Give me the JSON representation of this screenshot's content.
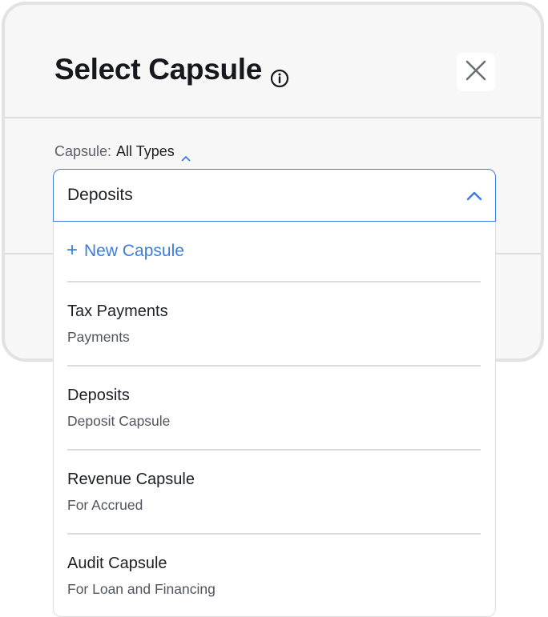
{
  "modal": {
    "title": "Select Capsule",
    "info_icon": "info-circle-icon",
    "close_icon": "close-icon"
  },
  "filter": {
    "label": "Capsule:",
    "value": "All Types",
    "chevron_icon": "chevron-up-icon"
  },
  "select": {
    "value": "Deposits",
    "chevron_icon": "chevron-up-icon",
    "accent_color": "#3b7ddd"
  },
  "dropdown": {
    "new_label": "New Capsule",
    "new_icon": "plus-icon",
    "options": [
      {
        "title": "Tax Payments",
        "subtitle": "Payments"
      },
      {
        "title": "Deposits",
        "subtitle": "Deposit Capsule"
      },
      {
        "title": "Revenue Capsule",
        "subtitle": "For Accrued"
      },
      {
        "title": "Audit Capsule",
        "subtitle": "For Loan and Financing"
      }
    ]
  }
}
